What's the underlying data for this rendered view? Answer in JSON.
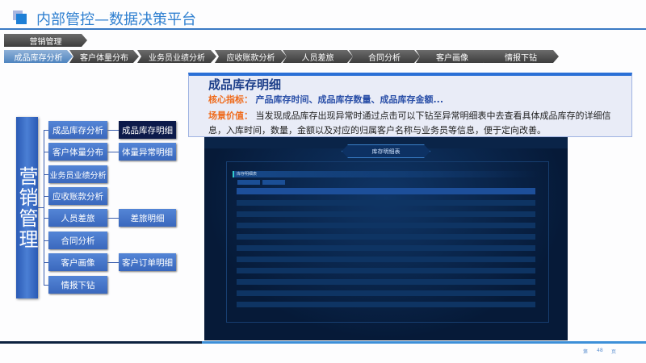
{
  "header": {
    "title": "内部管控—数据决策平台"
  },
  "breadcrumb": {
    "root": "营销管理",
    "tabs": [
      "成品库存分析",
      "客户体量分布",
      "业务员业绩分析",
      "应收账款分析",
      "人员差旅",
      "合同分析",
      "客户画像",
      "情报下钻"
    ]
  },
  "desc": {
    "title": "成品库存明细",
    "core_label": "核心指标：",
    "core_value": "产品库存时间、成品库存数量、成品库存金额...",
    "scene_label": "场景价值：",
    "scene_value": "当发现成品库存出现异常时通过点击可以下钻至异常明细表中去查看具体成品库存的详细信息，入库时间，数量，金额以及对应的归属客户名称与业务员等信息，便于定向改善。"
  },
  "dashboard": {
    "title": "库存明细表",
    "section": "库存明细表"
  },
  "tree": {
    "root": "营销管理",
    "level1": [
      "成品库存分析",
      "客户体量分布",
      "业务员业绩分析",
      "应收账款分析",
      "人员差旅",
      "合同分析",
      "客户画像",
      "情报下钻"
    ],
    "level2": {
      "0": "成品库存明细",
      "1": "体量异常明细",
      "4": "差旅明细",
      "6": "客户订单明细"
    }
  },
  "footer": {
    "prefix": "第",
    "page": "48",
    "suffix": "页"
  }
}
